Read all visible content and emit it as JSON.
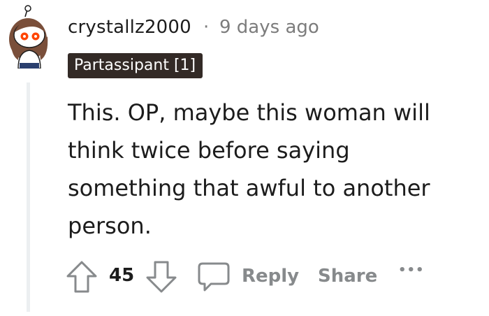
{
  "comment": {
    "author": "crystallz2000",
    "separator": "·",
    "timestamp": "9 days ago",
    "flair": "Partassipant [1]",
    "body": "This. OP, maybe this woman will think twice before saying something that awful to another person."
  },
  "actions": {
    "vote_count": "45",
    "reply_label": "Reply",
    "share_label": "Share",
    "more_label": "•••"
  },
  "colors": {
    "flair_bg": "#332a26",
    "action_gray": "#878a8c",
    "thread_line": "#eceff1",
    "avatar_accent": "#ff4500"
  },
  "icons": [
    "avatar-icon",
    "upvote-arrow-icon",
    "downvote-arrow-icon",
    "comment-bubble-icon",
    "more-options-icon"
  ]
}
